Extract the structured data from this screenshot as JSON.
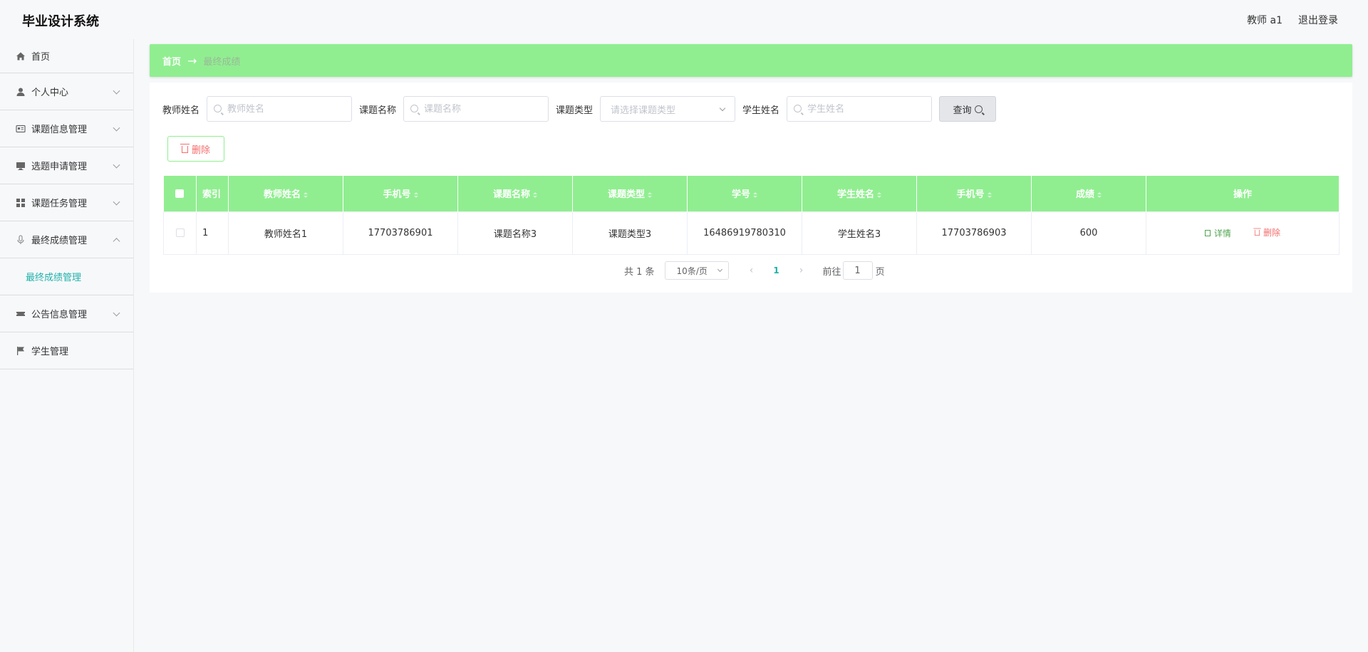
{
  "header": {
    "title": "毕业设计系统",
    "user": "教师 a1",
    "logout": "退出登录"
  },
  "sidebar": {
    "items": [
      {
        "label": "首页",
        "icon": "home-icon"
      },
      {
        "label": "个人中心",
        "icon": "user-icon"
      },
      {
        "label": "课题信息管理",
        "icon": "id-card-icon"
      },
      {
        "label": "选题申请管理",
        "icon": "monitor-icon"
      },
      {
        "label": "课题任务管理",
        "icon": "grid-icon"
      },
      {
        "label": "最终成绩管理",
        "icon": "microphone-icon"
      },
      {
        "label": "公告信息管理",
        "icon": "ticket-icon"
      },
      {
        "label": "学生管理",
        "icon": "flag-icon"
      }
    ],
    "submenu_active": "最终成绩管理"
  },
  "breadcrumb": {
    "home": "首页",
    "arrow": "→",
    "current": "最终成绩"
  },
  "search": {
    "teacher_label": "教师姓名",
    "teacher_placeholder": "教师姓名",
    "topic_label": "课题名称",
    "topic_placeholder": "课题名称",
    "type_label": "课题类型",
    "type_placeholder": "请选择课题类型",
    "student_label": "学生姓名",
    "student_placeholder": "学生姓名",
    "query_button": "查询"
  },
  "toolbar": {
    "delete_button": "删除"
  },
  "table": {
    "headers": [
      "索引",
      "教师姓名",
      "手机号",
      "课题名称",
      "课题类型",
      "学号",
      "学生姓名",
      "手机号",
      "成绩",
      "操作"
    ],
    "rows": [
      {
        "index": "1",
        "teacher_name": "教师姓名1",
        "teacher_phone": "17703786901",
        "topic_name": "课题名称3",
        "topic_type": "课题类型3",
        "student_id": "16486919780310",
        "student_name": "学生姓名3",
        "student_phone": "17703786903",
        "score": "600",
        "detail": "详情",
        "delete": "删除"
      }
    ]
  },
  "pagination": {
    "total": "共 1 条",
    "page_size": "10条/页",
    "current_page": "1",
    "goto_prefix": "前往",
    "goto_value": "1",
    "goto_suffix": "页"
  },
  "colors": {
    "accent": "#90ee90",
    "link": "#20b2aa",
    "danger": "#f56c6c"
  }
}
